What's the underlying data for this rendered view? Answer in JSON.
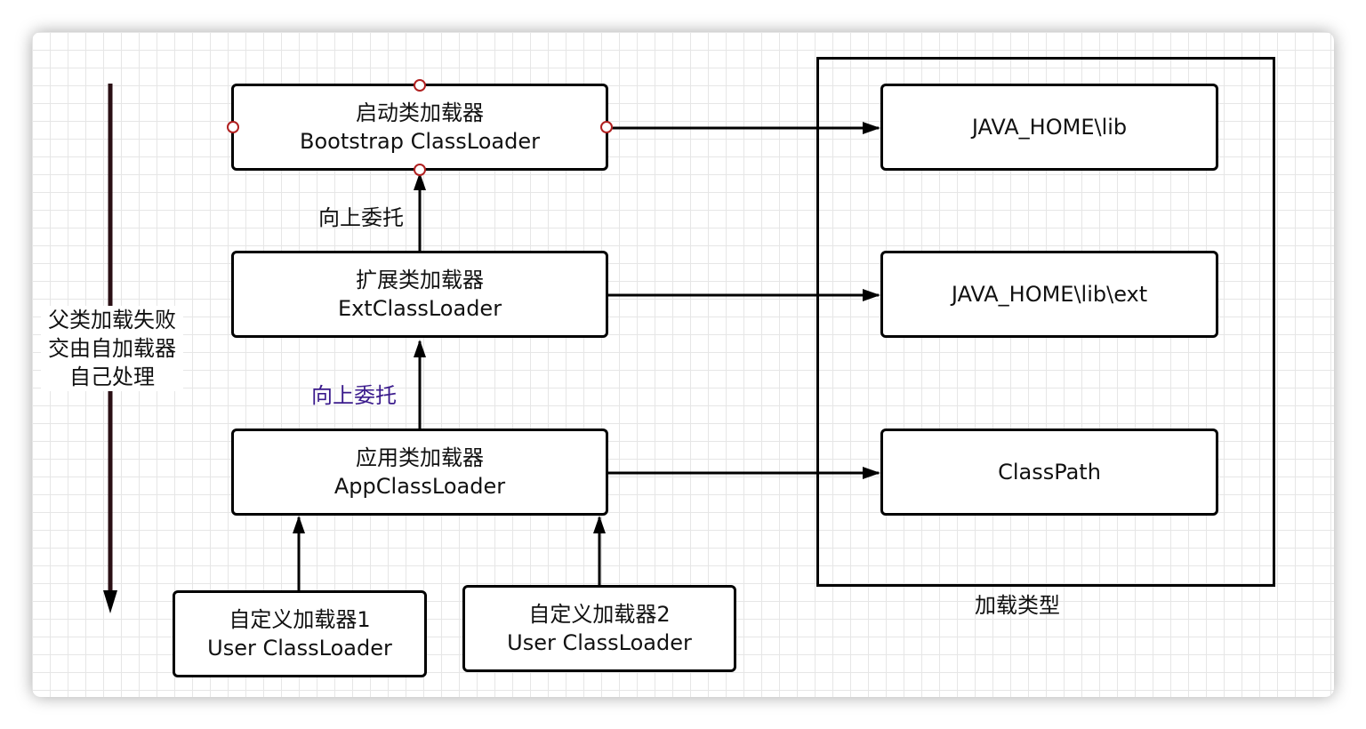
{
  "nodes": {
    "bootstrap": {
      "line1": "启动类加载器",
      "line2": "Bootstrap ClassLoader"
    },
    "ext": {
      "line1": "扩展类加载器",
      "line2": "ExtClassLoader"
    },
    "app": {
      "line1": "应用类加载器",
      "line2": "AppClassLoader"
    },
    "user1": {
      "line1": "自定义加载器1",
      "line2": "User ClassLoader"
    },
    "user2": {
      "line1": "自定义加载器2",
      "line2": "User ClassLoader"
    }
  },
  "paths": {
    "java_home_lib": "JAVA_HOME\\lib",
    "java_home_lib_ext": "JAVA_HOME\\lib\\ext",
    "classpath": "ClassPath"
  },
  "edge_labels": {
    "delegate_upper": "向上委托",
    "delegate_lower": "向上委托"
  },
  "failure_note": {
    "line1": "父类加载失败",
    "line2": "交由自加载器",
    "line3": "自己处理"
  },
  "container_label": "加载类型",
  "colors": {
    "stroke": "#000000",
    "text": "#111111",
    "highlight_label": "#3a1a8c",
    "down_arrow": "#2a0f14"
  }
}
